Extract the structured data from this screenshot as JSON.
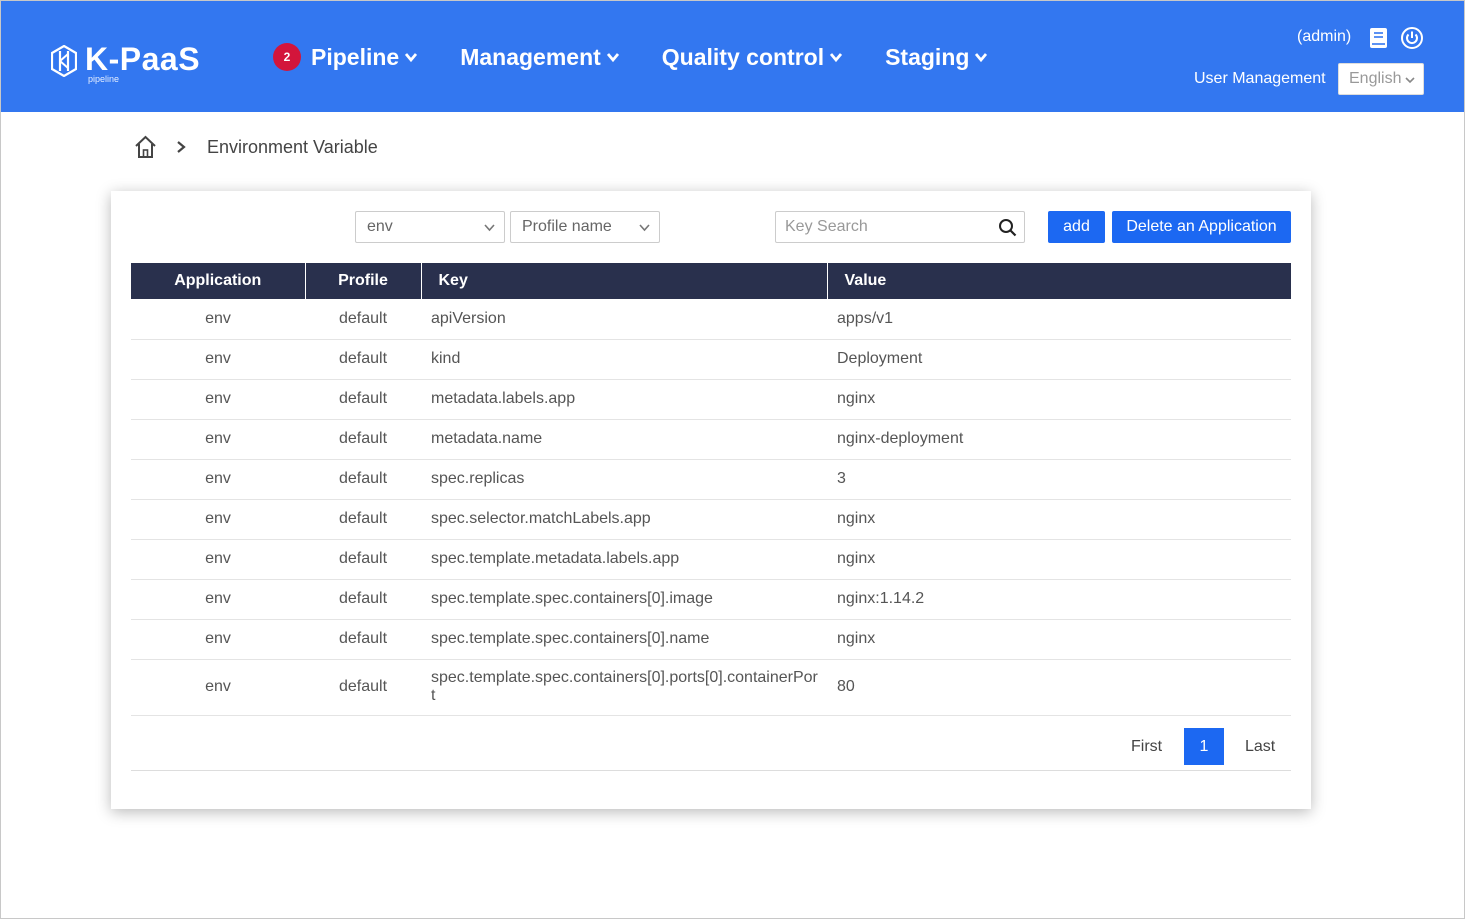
{
  "header": {
    "logo_text": "K-PaaS",
    "logo_sub": "pipeline",
    "nav": [
      {
        "label": "Pipeline",
        "badge": "2"
      },
      {
        "label": "Management"
      },
      {
        "label": "Quality control"
      },
      {
        "label": "Staging"
      }
    ],
    "user": "(admin)",
    "user_management": "User Management",
    "language": "English",
    "icons": [
      "book-icon",
      "power-icon"
    ]
  },
  "breadcrumb": {
    "title": "Environment Variable"
  },
  "filters": {
    "application_select": "env",
    "profile_select": "Profile name",
    "search_placeholder": "Key Search",
    "add_label": "add",
    "delete_label": "Delete an Application"
  },
  "table": {
    "columns": [
      "Application",
      "Profile",
      "Key",
      "Value"
    ],
    "rows": [
      {
        "app": "env",
        "profile": "default",
        "key": "apiVersion",
        "value": "apps/v1"
      },
      {
        "app": "env",
        "profile": "default",
        "key": "kind",
        "value": "Deployment"
      },
      {
        "app": "env",
        "profile": "default",
        "key": "metadata.labels.app",
        "value": "nginx"
      },
      {
        "app": "env",
        "profile": "default",
        "key": "metadata.name",
        "value": "nginx-deployment"
      },
      {
        "app": "env",
        "profile": "default",
        "key": "spec.replicas",
        "value": "3"
      },
      {
        "app": "env",
        "profile": "default",
        "key": "spec.selector.matchLabels.app",
        "value": "nginx"
      },
      {
        "app": "env",
        "profile": "default",
        "key": "spec.template.metadata.labels.app",
        "value": "nginx"
      },
      {
        "app": "env",
        "profile": "default",
        "key": "spec.template.spec.containers[0].image",
        "value": "nginx:1.14.2"
      },
      {
        "app": "env",
        "profile": "default",
        "key": "spec.template.spec.containers[0].name",
        "value": "nginx"
      },
      {
        "app": "env",
        "profile": "default",
        "key": "spec.template.spec.containers[0].ports[0].containerPort",
        "value": "80"
      }
    ]
  },
  "pagination": {
    "first": "First",
    "current": "1",
    "last": "Last"
  },
  "colors": {
    "header": "#3377f0",
    "table_header": "#29304d",
    "button": "#1c68f2",
    "badge": "#d3153b"
  }
}
